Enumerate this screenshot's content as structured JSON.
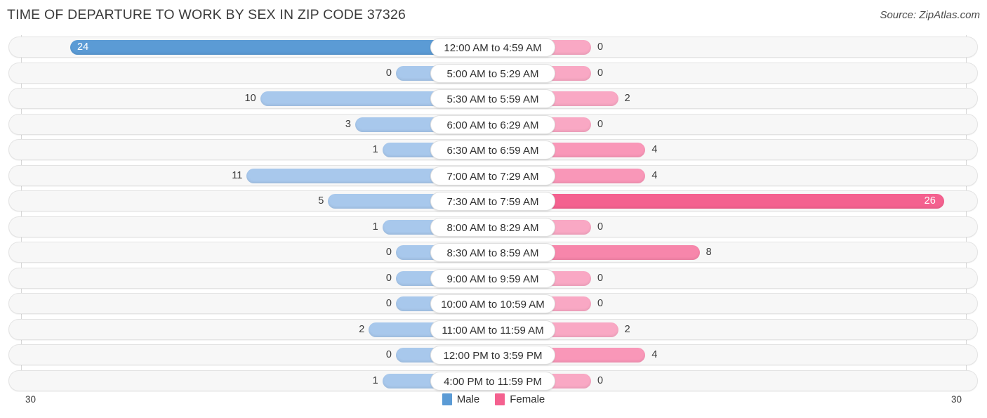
{
  "header": {
    "title": "TIME OF DEPARTURE TO WORK BY SEX IN ZIP CODE 37326",
    "source": "Source: ZipAtlas.com"
  },
  "footer": {
    "axis_left": "30",
    "axis_right": "30"
  },
  "colors": {
    "male_strong": "#5b9bd5",
    "male_light": "#a8c8ec",
    "female_strong": "#f4618f",
    "female_light": "#f9a8c4",
    "track": "#f7f7f7",
    "grid": "#d8d8d8"
  },
  "legend": [
    {
      "label": "Male",
      "color": "#5b9bd5"
    },
    {
      "label": "Female",
      "color": "#f4618f"
    }
  ],
  "chart_data": {
    "type": "bar",
    "subtype": "diverging-bar",
    "title": "TIME OF DEPARTURE TO WORK BY SEX IN ZIP CODE 37326",
    "xlabel": "",
    "ylabel": "",
    "xlim": [
      30,
      30
    ],
    "grid": true,
    "legend_position": "bottom-center",
    "categories": [
      "12:00 AM to 4:59 AM",
      "5:00 AM to 5:29 AM",
      "5:30 AM to 5:59 AM",
      "6:00 AM to 6:29 AM",
      "6:30 AM to 6:59 AM",
      "7:00 AM to 7:29 AM",
      "7:30 AM to 7:59 AM",
      "8:00 AM to 8:29 AM",
      "8:30 AM to 8:59 AM",
      "9:00 AM to 9:59 AM",
      "10:00 AM to 10:59 AM",
      "11:00 AM to 11:59 AM",
      "12:00 PM to 3:59 PM",
      "4:00 PM to 11:59 PM"
    ],
    "series": [
      {
        "name": "Male",
        "color": "#5b9bd5",
        "values": [
          24,
          0,
          10,
          3,
          1,
          11,
          5,
          1,
          0,
          0,
          0,
          2,
          0,
          1
        ],
        "labels": [
          "24",
          "0",
          "10",
          "3",
          "1",
          "11",
          "5",
          "1",
          "0",
          "0",
          "0",
          "2",
          "0",
          "1"
        ]
      },
      {
        "name": "Female",
        "color": "#f4618f",
        "values": [
          0,
          0,
          2,
          0,
          4,
          4,
          26,
          0,
          8,
          0,
          0,
          2,
          4,
          0
        ],
        "labels": [
          "0",
          "0",
          "2",
          "0",
          "4",
          "4",
          "26",
          "0",
          "8",
          "0",
          "0",
          "2",
          "4",
          "0"
        ]
      }
    ]
  }
}
